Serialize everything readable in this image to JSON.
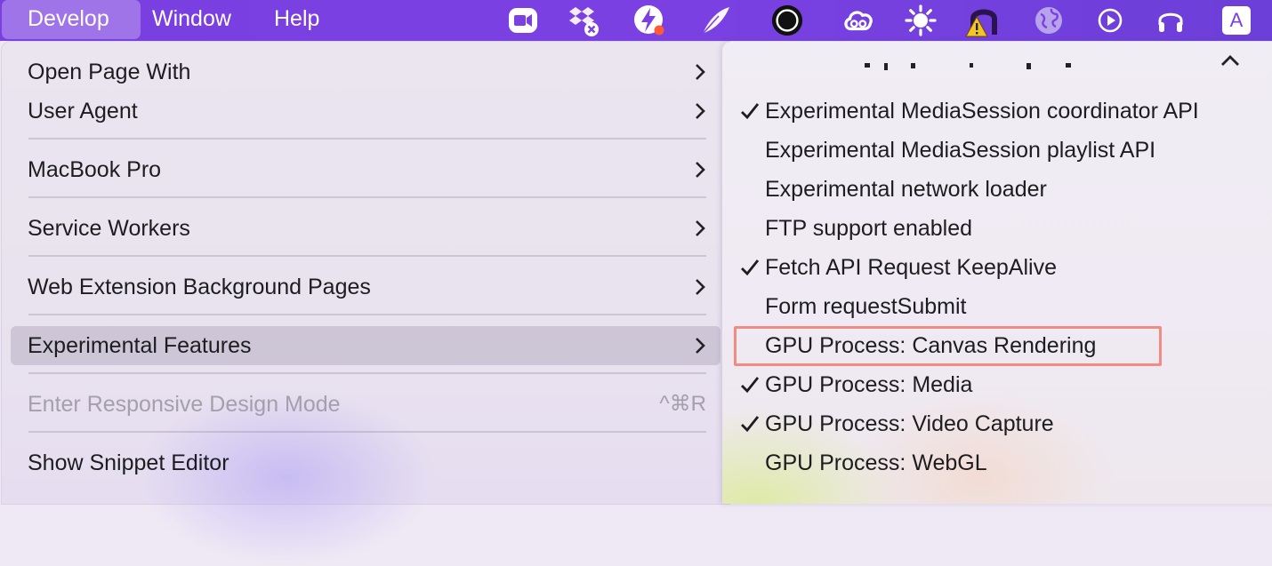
{
  "menubar": {
    "items": [
      {
        "label": "Develop",
        "active": true
      },
      {
        "label": "Window"
      },
      {
        "label": "Help"
      }
    ],
    "tray_icons": [
      "zoom-icon",
      "dropbox-icon",
      "bolt-icon",
      "quill-icon",
      "target-icon",
      "creative-cloud-icon",
      "sun-icon",
      "warning-icon",
      "globe-icon",
      "play-icon",
      "headphones-icon",
      "input-method-icon"
    ],
    "input_method_label": "A",
    "background": "#7a40e2"
  },
  "develop_menu": {
    "items": [
      {
        "label": "Open Page With",
        "submenu": true
      },
      {
        "label": "User Agent",
        "submenu": true
      },
      {
        "label": "MacBook Pro",
        "submenu": true
      },
      {
        "label": "Service Workers",
        "submenu": true
      },
      {
        "label": "Web Extension Background Pages",
        "submenu": true
      },
      {
        "label": "Experimental Features",
        "submenu": true,
        "highlighted": true
      },
      {
        "label": "Enter Responsive Design Mode",
        "disabled": true,
        "shortcut": "^⌘R"
      },
      {
        "label": "Show Snippet Editor"
      }
    ]
  },
  "experimental_features": {
    "items": [
      {
        "label": "Experimental MediaSession coordinator API",
        "checked": true
      },
      {
        "label": "Experimental MediaSession playlist API",
        "checked": false
      },
      {
        "label": "Experimental network loader",
        "checked": false
      },
      {
        "label": "FTP support enabled",
        "checked": false
      },
      {
        "label": "Fetch API Request KeepAlive",
        "checked": true
      },
      {
        "label": "Form requestSubmit",
        "checked": false
      },
      {
        "label": "GPU Process: Canvas Rendering",
        "checked": false,
        "outlined": true
      },
      {
        "label": "GPU Process: Media",
        "checked": true
      },
      {
        "label": "GPU Process: Video Capture",
        "checked": true
      },
      {
        "label": "GPU Process: WebGL",
        "checked": false
      }
    ],
    "outline_color": "#f28c83"
  }
}
